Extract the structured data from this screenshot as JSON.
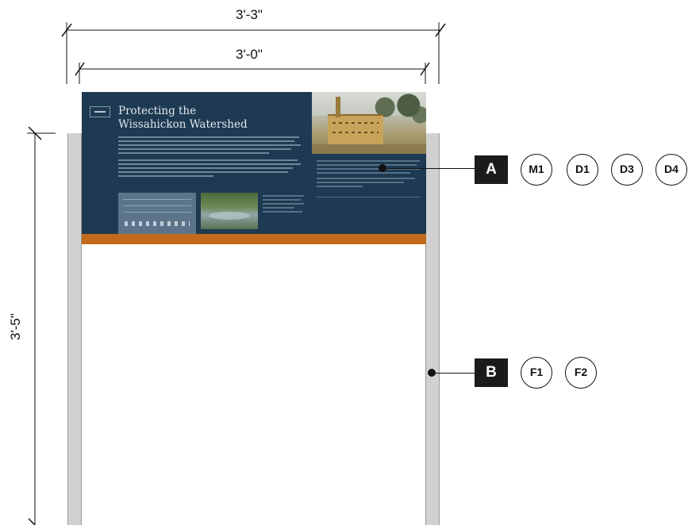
{
  "dimensions": {
    "overall_width": "3'-3\"",
    "panel_width": "3'-0\"",
    "overall_height": "3'-5\""
  },
  "panel": {
    "title": "Protecting the\nWissahickon Watershed",
    "background_color": "#1e3a52",
    "band_color": "#c26a1c"
  },
  "callouts": [
    {
      "tag": "A",
      "codes": [
        "M1",
        "D1",
        "D3",
        "D4"
      ]
    },
    {
      "tag": "B",
      "codes": [
        "F1",
        "F2"
      ]
    }
  ],
  "colors": {
    "post": "#d1d1d1",
    "line": "#111111",
    "tag_box": "#1b1b1b"
  }
}
